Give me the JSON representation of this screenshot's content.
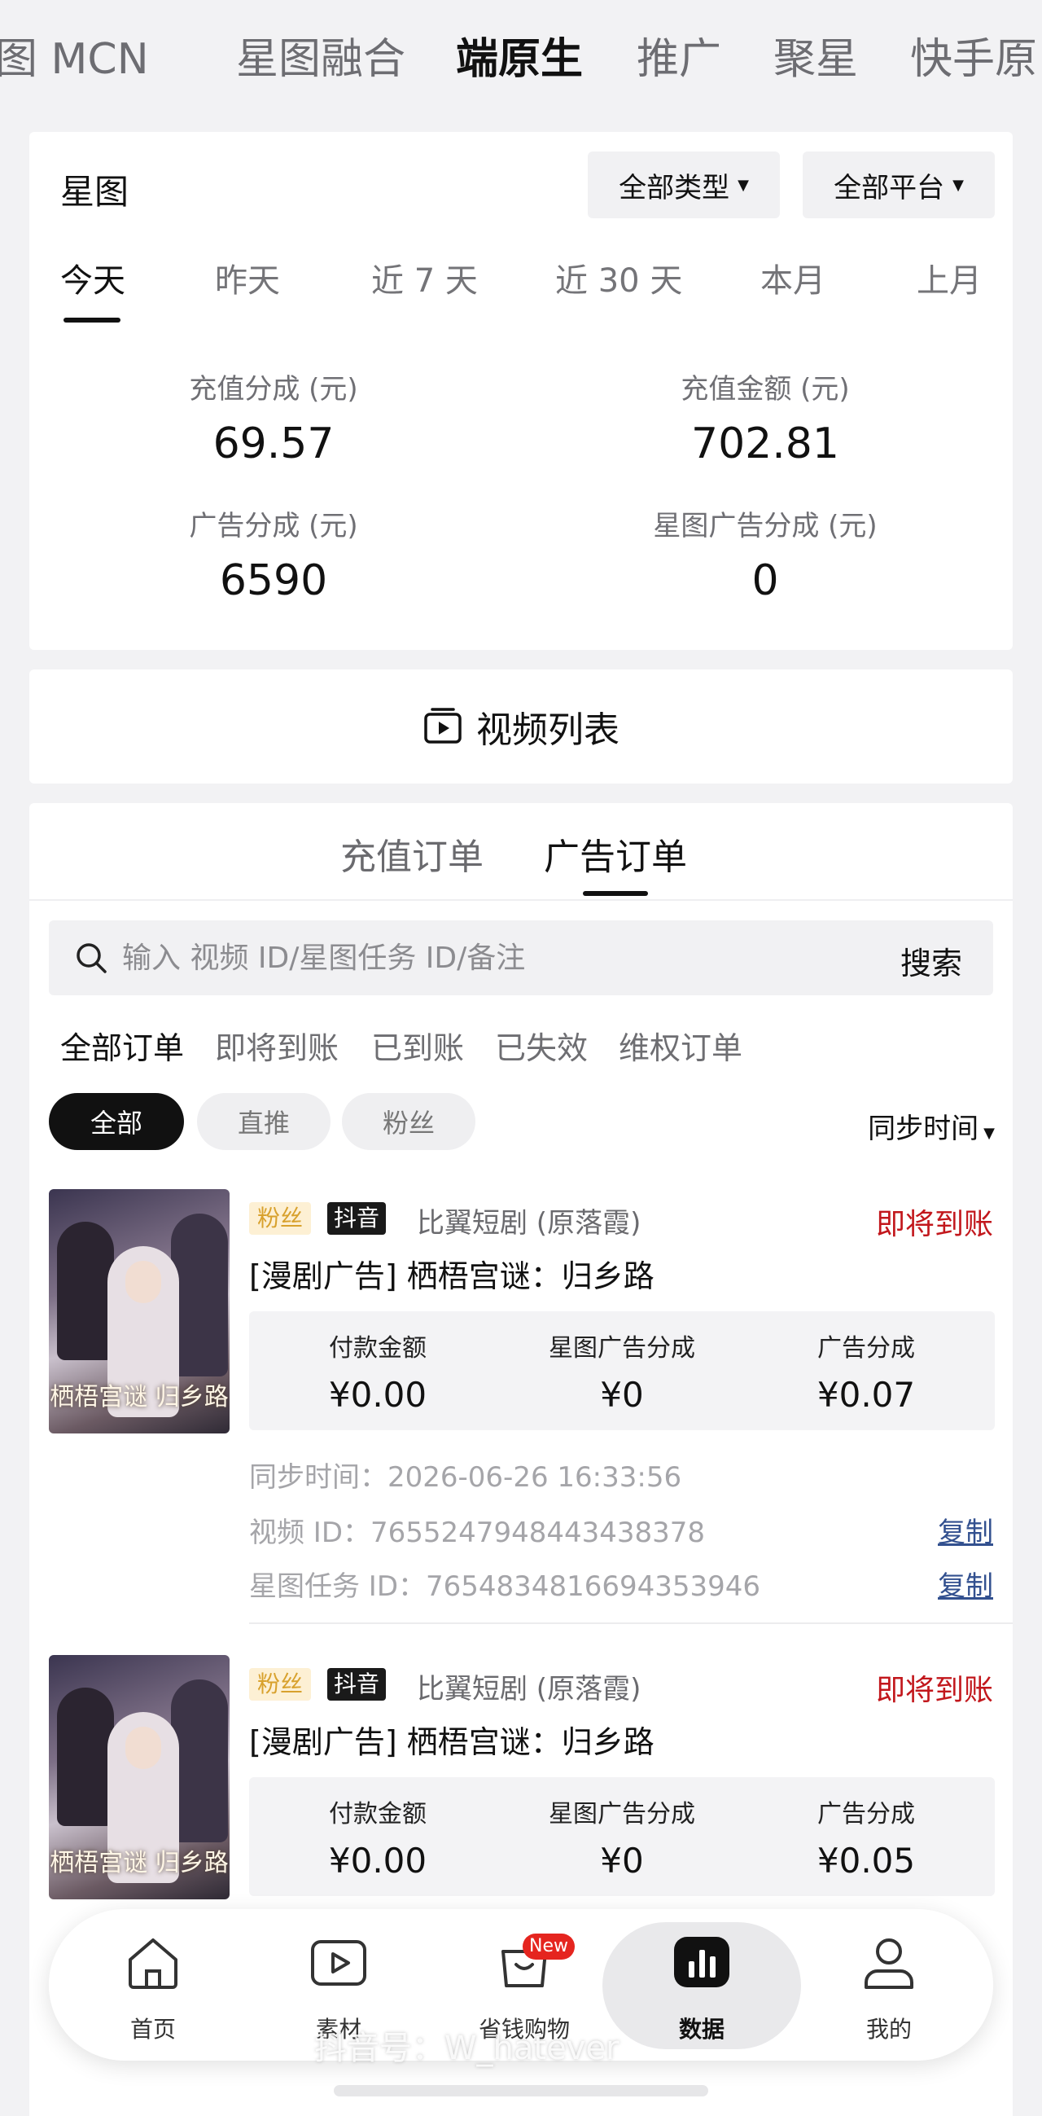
{
  "top_tabs": [
    "图 MCN",
    "星图融合",
    "端原生",
    "推广",
    "聚星",
    "快手原"
  ],
  "stats": {
    "title": "星图",
    "type_filter": "全部类型",
    "platform_filter": "全部平台",
    "date_tabs": [
      "今天",
      "昨天",
      "近 7 天",
      "近 30 天",
      "本月",
      "上月"
    ],
    "items": [
      {
        "label": "充值分成 (元)",
        "value": "69.57"
      },
      {
        "label": "充值金额 (元)",
        "value": "702.81"
      },
      {
        "label": "广告分成 (元)",
        "value": "6590"
      },
      {
        "label": "星图广告分成 (元)",
        "value": "0"
      }
    ]
  },
  "video_list_label": "视频列表",
  "orders": {
    "tabs": [
      "充值订单",
      "广告订单"
    ],
    "active_tab": "广告订单",
    "search": {
      "placeholder": "输入 视频 ID/星图任务 ID/备注",
      "button": "搜索"
    },
    "status_tabs": [
      "全部订单",
      "即将到账",
      "已到账",
      "已失效",
      "维权订单"
    ],
    "chips": [
      "全部",
      "直推",
      "粉丝"
    ],
    "sort_label": "同步时间",
    "items": [
      {
        "badge_fan": "粉丝",
        "badge_platform": "抖音",
        "seller": "比翼短剧 (原落霞)",
        "status": "即将到账",
        "title": "[漫剧广告] 栖梧宫谜：归乡路",
        "thumb_text": "栖梧宫谜 归乡路",
        "amounts": [
          {
            "label": "付款金额",
            "value": "¥0.00"
          },
          {
            "label": "星图广告分成",
            "value": "¥0"
          },
          {
            "label": "广告分成",
            "value": "¥0.07"
          }
        ],
        "sync_time": "同步时间：2026-06-26 16:33:56",
        "video_id": "视频 ID：7655247948443438378",
        "task_id": "星图任务 ID：7654834816694353946",
        "copy_label": "复制"
      },
      {
        "badge_fan": "粉丝",
        "badge_platform": "抖音",
        "seller": "比翼短剧 (原落霞)",
        "status": "即将到账",
        "title": "[漫剧广告] 栖梧宫谜：归乡路",
        "thumb_text": "栖梧宫谜 归乡路",
        "amounts": [
          {
            "label": "付款金额",
            "value": "¥0.00"
          },
          {
            "label": "星图广告分成",
            "value": "¥0"
          },
          {
            "label": "广告分成",
            "value": "¥0.05"
          }
        ]
      }
    ]
  },
  "bottom_nav": {
    "items": [
      "首页",
      "素材",
      "省钱购物",
      "数据",
      "我的"
    ],
    "active": "数据",
    "new_badge": "New"
  },
  "watermark": "抖音号：W_hatever"
}
